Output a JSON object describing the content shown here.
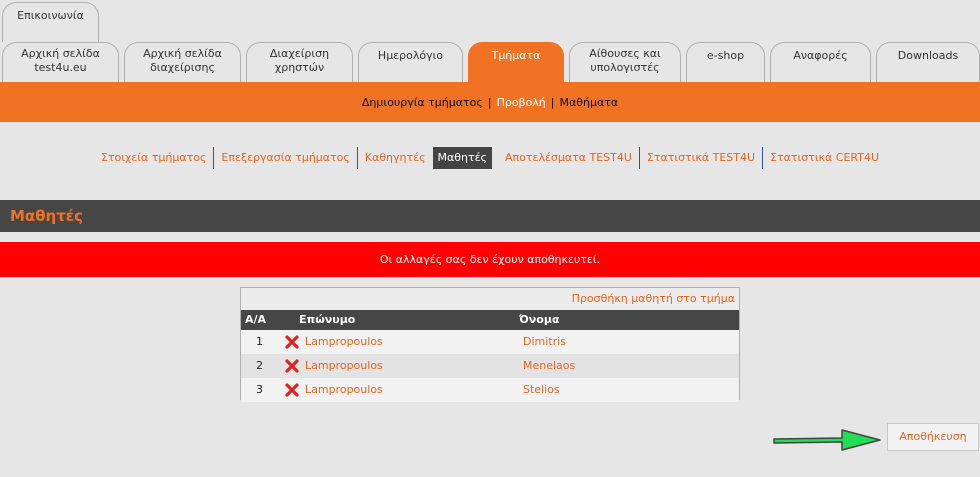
{
  "top_tab": "Επικοινωνία",
  "tabs": [
    {
      "line1": "Αρχική σελίδα",
      "line2": "test4u.eu"
    },
    {
      "line1": "Αρχική σελίδα",
      "line2": "διαχείρισης"
    },
    {
      "line1": "Διαχείριση",
      "line2": "χρηστών"
    },
    {
      "line1": "Ημερολόγιο",
      "line2": ""
    },
    {
      "line1": "Τμήματα",
      "line2": ""
    },
    {
      "line1": "Αίθουσες και",
      "line2": "υπολογιστές"
    },
    {
      "line1": "e-shop",
      "line2": ""
    },
    {
      "line1": "Αναφορές",
      "line2": ""
    },
    {
      "line1": "Downloads",
      "line2": ""
    }
  ],
  "orange_nav": {
    "create": "Δημιουργία τμήματος",
    "view": "Προβολή",
    "lessons": "Μαθήματα",
    "separator": "|"
  },
  "sub_nav": [
    "Στοιχεία τμήματος",
    "Επεξεργασία τμήματος",
    "Καθηγητές",
    "Μαθητές",
    "Αποτελέσματα TEST4U",
    "Στατιστικά TEST4U",
    "Στατιστικά CERT4U"
  ],
  "section_title": "Μαθητές",
  "alert": "Οι αλλαγές σας δεν έχουν αποθηκευτεί.",
  "add_student_link": "Προσθήκη μαθητή στο τμήμα",
  "table": {
    "headers": {
      "aa": "Α/Α",
      "last": "Επώνυμο",
      "first": "Όνομα"
    },
    "rows": [
      {
        "aa": "1",
        "last": "Lampropoulos",
        "first": "Dimitris"
      },
      {
        "aa": "2",
        "last": "Lampropoulos",
        "first": "Menelaos"
      },
      {
        "aa": "3",
        "last": "Lampropoulos",
        "first": "Stelios"
      }
    ]
  },
  "save_button": "Αποθήκευση",
  "colors": {
    "accent": "#f07222",
    "dark_bar": "#464646",
    "alert": "#ff0000",
    "arrow": "#22dd55"
  }
}
